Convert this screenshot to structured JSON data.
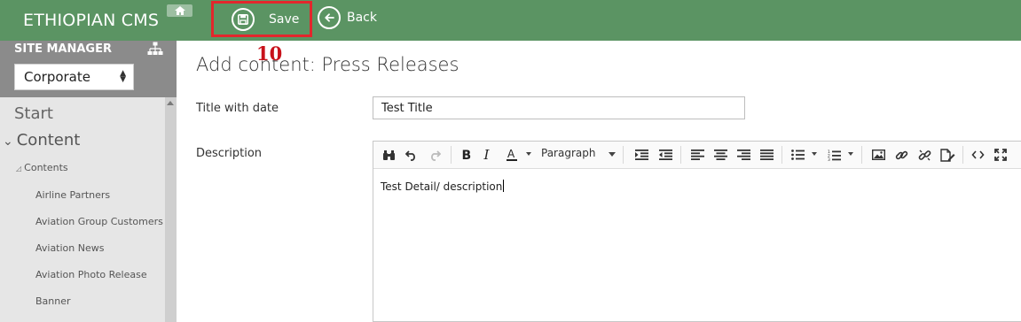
{
  "app": {
    "title": "ETHIOPIAN CMS"
  },
  "toolbar": {
    "save_label": "Save",
    "back_label": "Back",
    "step_marker": "10"
  },
  "sidebar": {
    "header": "SITE MANAGER",
    "site_select_value": "Corporate",
    "nav": {
      "start": "Start",
      "content": "Content",
      "contents": "Contents",
      "items": [
        "Airline Partners",
        "Aviation Group Customers",
        "Aviation News",
        "Aviation Photo Release",
        "Banner"
      ]
    }
  },
  "main": {
    "page_title": "Add content: Press Releases",
    "title_label": "Title with date",
    "title_value": "Test Title",
    "description_label": "Description",
    "editor": {
      "format_value": "Paragraph",
      "body_text": "Test Detail/ description"
    }
  },
  "colors": {
    "topbar": "#5b9463",
    "highlight": "#e3262c",
    "marker": "#c8121b"
  }
}
